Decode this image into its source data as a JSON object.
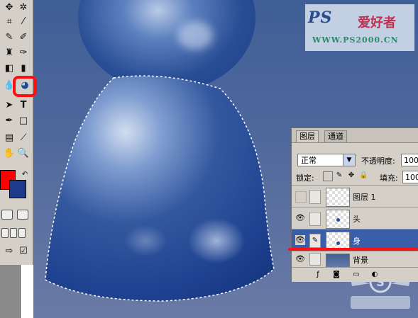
{
  "watermark": {
    "brand": "PS",
    "brand_cn": "爱好者",
    "url": "WWW.PS2000.CN"
  },
  "toolbox": {
    "tools": [
      "move-icon",
      "crop-icon",
      "slice-icon",
      "healing-brush-icon",
      "brush-icon",
      "clone-stamp-icon",
      "history-brush-icon",
      "eraser-icon",
      "gradient-icon",
      "blur-icon",
      "dodge-icon",
      "path-selection-icon",
      "type-icon",
      "pen-icon",
      "shape-icon",
      "notes-icon",
      "eyedropper-icon",
      "hand-icon",
      "zoom-icon"
    ],
    "foreground_color": "#ff0000",
    "background_color": "#1e3a8a",
    "highlighted_tool": "dodge-icon"
  },
  "layers_panel": {
    "tabs": [
      "图层",
      "通道"
    ],
    "blend_mode": "正常",
    "opacity_label": "不透明度:",
    "opacity_value": "100",
    "lock_label": "锁定:",
    "fill_label": "填充:",
    "fill_value": "100",
    "layers": [
      {
        "name": "图层 1",
        "visible": false,
        "selected": false
      },
      {
        "name": "头",
        "visible": true,
        "selected": false
      },
      {
        "name": "身",
        "visible": true,
        "selected": true
      },
      {
        "name": "背景",
        "visible": true,
        "selected": false
      }
    ]
  },
  "colors": {
    "annotation_red": "#ff1010",
    "selected_layer": "#3a5ea8"
  }
}
